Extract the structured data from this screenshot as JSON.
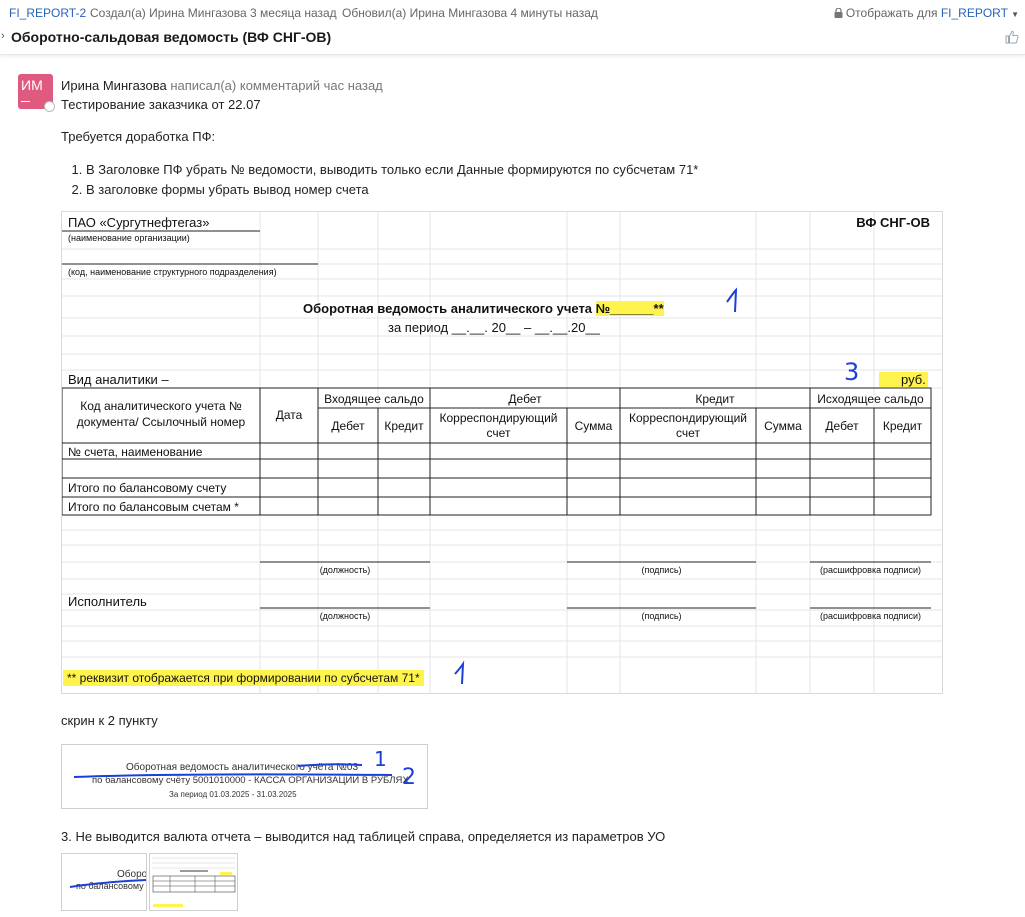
{
  "topbar": {
    "issue_key": "FI_REPORT-2",
    "created": "Создал(а) Ирина Мингазова 3 месяца назад",
    "updated": "Обновил(а) Ирина Мингазова 4 минуты назад",
    "visibility_prefix": "Отображать для",
    "visibility_project": "FI_REPORT"
  },
  "issue": {
    "title": "Оборотно-сальдовая ведомость (ВФ СНГ-ОВ)"
  },
  "comment": {
    "avatar_initials": "ИМ",
    "author": "Ирина Мингазова",
    "action": "написал(а) комментарий час назад",
    "line1": "Тестирование заказчика от 22.07",
    "line2": "Требуется доработка ПФ:",
    "items": [
      "В Заголовке ПФ убрать № ведомости, выводить только если Данные формируются по субсчетам 71*",
      "В заголовке формы убрать вывод номер счета"
    ],
    "screen_caption": "скрин к 2 пункту",
    "point3": "3. Не выводится валюта отчета – выводится над таблицей справа, определяется из параметров УО"
  },
  "sheet": {
    "org": "ПАО «Сургутнефтегаз»",
    "form_code": "ВФ СНГ-ОВ",
    "org_caption": "(наименование организации)",
    "dept_caption": "(код, наименование структурного подразделения)",
    "report_title": "Оборотная ведомость аналитического учета ",
    "report_number": "№______**",
    "period": "за период __.__. 20__ – __.__.20__",
    "analytics": "Вид аналитики –",
    "currency": "руб.",
    "col_code": "Код аналитического учета № документа/ Ссылочный номер",
    "col_date": "Дата",
    "col_open": "Входящее сальдо",
    "col_debit": "Дебет",
    "col_credit": "Кредит",
    "col_close": "Исходящее сальдо",
    "sub_debit": "Дебет",
    "sub_credit": "Кредит",
    "sub_corr": "Корреспондирующий счет",
    "sub_sum": "Сумма",
    "row_account": "№ счета, наименование",
    "row_total1": "Итого по балансовому счету",
    "row_total2": "Итого по балансовым счетам *",
    "sig_position": "(должность)",
    "sig_signature": "(подпись)",
    "sig_decode": "(расшифровка подписи)",
    "executor": "Исполнитель",
    "footnote": "** реквизит отображается при формировании по субсчетам 71*",
    "mark1": "1",
    "mark3": "3"
  },
  "thumb1": {
    "line1": "Оборотная ведомость аналитического учёта №03",
    "line2": "по балансовому счёту 5001010000 - КАССА ОРГАНИЗАЦИИ В РУБЛЯХ",
    "line3": "За период 01.03.2025 - 31.03.2025",
    "mark1": "1",
    "mark2": "2"
  },
  "thumb2": {
    "line1": "Оборо",
    "line2": "по балансовому"
  },
  "colors": {
    "link": "#2a62b8",
    "highlight": "#fff44d",
    "ink": "#1b3fd8",
    "avatar": "#e05a80"
  },
  "icons": [
    "lock-icon",
    "chevron-down-icon",
    "thumbs-up-icon"
  ]
}
